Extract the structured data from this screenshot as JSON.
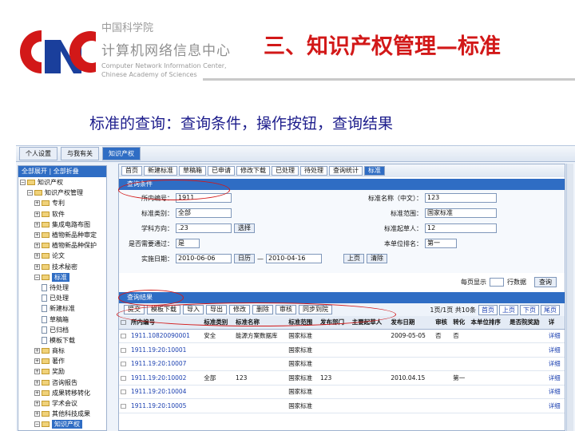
{
  "header": {
    "org_cn_small": "中国科学院",
    "org_cn_big": "计算机网络信息中心",
    "org_en_line1": "Computer Network Information Center,",
    "org_en_line2": "Chinese Academy of Sciences",
    "title": "三、知识产权管理—标准",
    "subtitle": "标准的查询：查询条件，操作按钮，查询结果"
  },
  "colors": {
    "title_red": "#d21818",
    "subtitle_blue": "#1d1d8c",
    "accent_blue": "#2f6dc4"
  },
  "app": {
    "top_tabs": [
      "个人设置",
      "与我有关",
      "知识产权"
    ],
    "tree": {
      "header": "全部展开 | 全部折叠",
      "nodes": [
        {
          "label": "知识产权",
          "level": 0,
          "type": "folder"
        },
        {
          "label": "知识产权管理",
          "level": 1,
          "type": "folder"
        },
        {
          "label": "专利",
          "level": 2,
          "type": "folder"
        },
        {
          "label": "软件",
          "level": 2,
          "type": "folder"
        },
        {
          "label": "集成电路布图",
          "level": 2,
          "type": "folder"
        },
        {
          "label": "植物新品种审定",
          "level": 2,
          "type": "folder"
        },
        {
          "label": "植物新品种保护",
          "level": 2,
          "type": "folder"
        },
        {
          "label": "论文",
          "level": 2,
          "type": "folder"
        },
        {
          "label": "技术秘密",
          "level": 2,
          "type": "folder"
        },
        {
          "label": "标准",
          "level": 2,
          "type": "folder",
          "selected": true
        },
        {
          "label": "待处理",
          "level": 3,
          "type": "doc"
        },
        {
          "label": "已处理",
          "level": 3,
          "type": "doc"
        },
        {
          "label": "新建标准",
          "level": 3,
          "type": "doc"
        },
        {
          "label": "草稿箱",
          "level": 3,
          "type": "doc"
        },
        {
          "label": "已归档",
          "level": 3,
          "type": "doc"
        },
        {
          "label": "模板下载",
          "level": 3,
          "type": "doc"
        },
        {
          "label": "商标",
          "level": 2,
          "type": "folder"
        },
        {
          "label": "著作",
          "level": 2,
          "type": "folder"
        },
        {
          "label": "奖励",
          "level": 2,
          "type": "folder"
        },
        {
          "label": "咨询报告",
          "level": 2,
          "type": "folder"
        },
        {
          "label": "成果转移转化",
          "level": 2,
          "type": "folder"
        },
        {
          "label": "学术会议",
          "level": 2,
          "type": "folder"
        },
        {
          "label": "其他科技成果",
          "level": 2,
          "type": "folder"
        },
        {
          "label": "知识产权",
          "level": 2,
          "type": "folder",
          "selected": true
        }
      ]
    },
    "toolbar_buttons": [
      "首页",
      "新建标准",
      "草稿箱",
      "已申请",
      "修改下载",
      "已处理",
      "待处理",
      "查询统计",
      "标准"
    ],
    "query_panel": {
      "header": "查询条件",
      "fields": {
        "internal_no_label": "所内编号：",
        "internal_no_value": "1911",
        "std_name_label": "标准名称（中文）：",
        "std_name_value": "123",
        "std_type_label": "标准类别：",
        "std_type_value": "全部",
        "std_scope_label": "标准范围：",
        "std_scope_value": "国家标准",
        "discipline_label": "学科方向：",
        "discipline_value": ".23",
        "select_button": "选择",
        "drafter_label": "标准起草人：",
        "drafter_value": "12",
        "rank_label": "是否需要通过：",
        "rank_value": "是",
        "unit_rank_label": "本单位排名：",
        "unit_rank_value": "第一",
        "impl_date_label": "实施日期：",
        "impl_date_from": "2010-06-06",
        "date_sep": "—",
        "impl_date_to": "2010-04-16",
        "calendar_label": "日历",
        "query_button": "上页",
        "clear_button": "清除"
      }
    },
    "page_row": {
      "per_page_label": "每页显示",
      "rows_label": "行数据",
      "go_button": "查询"
    },
    "result_panel": {
      "header": "查询结果",
      "buttons": [
        "提交",
        "模板下载",
        "导入",
        "导出",
        "修改",
        "删除",
        "审核",
        "同步到院"
      ],
      "pager_text": "1页/1页 共10条",
      "pager_buttons": [
        "首页",
        "上页",
        "下页",
        "尾页"
      ],
      "columns": [
        "所内编号",
        "标准类别",
        "标准名称",
        "标准范围",
        "发布部门",
        "主要起草人",
        "发布日期",
        "审核",
        "转化",
        "本单位排序",
        "是否院奖励",
        "详"
      ],
      "rows": [
        [
          "1911.10820090001",
          "安全",
          "能源方案数据库",
          "国家标准",
          "",
          "",
          "2009-05-05",
          "否",
          "否",
          "",
          "",
          "详细"
        ],
        [
          "1911.19:20:10001",
          "",
          "",
          "国家标准",
          "",
          "",
          "",
          "",
          "",
          "",
          "",
          "详细"
        ],
        [
          "1911.19:20:10007",
          "",
          "",
          "国家标准",
          "",
          "",
          "",
          "",
          "",
          "",
          "",
          "详细"
        ],
        [
          "1911.19:20:10002",
          "全部",
          "123",
          "国家标准",
          "123",
          "",
          "2010.04.15",
          "",
          "第一",
          "",
          "",
          "详细"
        ],
        [
          "1911.19:20:10004",
          "",
          "",
          "国家标准",
          "",
          "",
          "",
          "",
          "",
          "",
          "",
          "详细"
        ],
        [
          "1911.19:20:10005",
          "",
          "",
          "国家标准",
          "",
          "",
          "",
          "",
          "",
          "",
          "",
          "详细"
        ]
      ]
    }
  }
}
